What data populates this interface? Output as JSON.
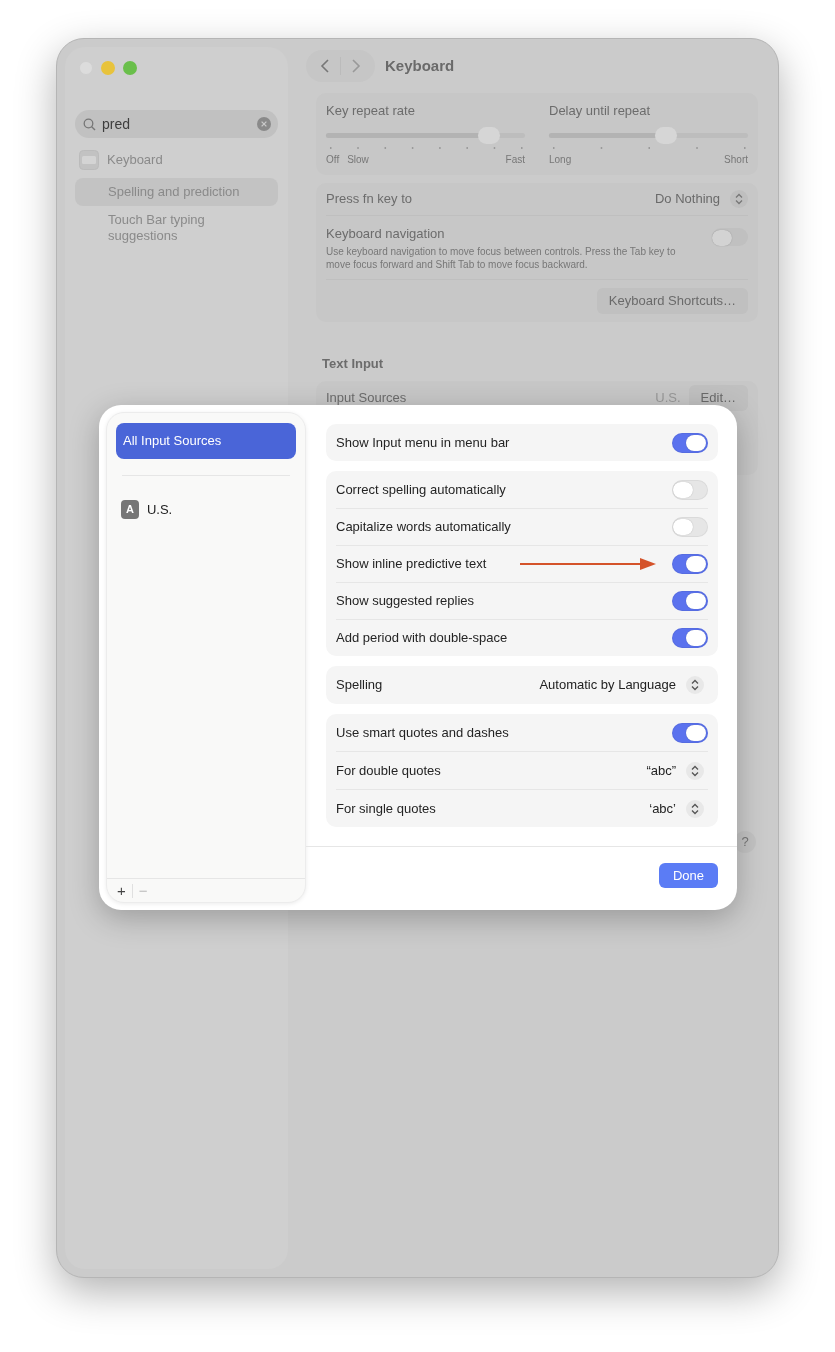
{
  "window": {
    "title": "Keyboard",
    "help": "?"
  },
  "sidebar": {
    "search": {
      "value": "pred"
    },
    "items": [
      {
        "label": "Keyboard",
        "kind": "category",
        "selected": false
      },
      {
        "label": "Spelling and prediction",
        "kind": "result",
        "selected": true
      },
      {
        "label": "Touch Bar typing suggestions",
        "kind": "result",
        "selected": false
      }
    ]
  },
  "sliders": [
    {
      "label": "Key repeat rate",
      "level": 0.82,
      "start_labels": [
        "Off",
        "Slow"
      ],
      "end_label": "Fast"
    },
    {
      "label": "Delay until repeat",
      "level": 0.59,
      "start_labels": [
        "Long"
      ],
      "end_label": "Short"
    }
  ],
  "fn_key": {
    "label": "Press fn key to",
    "value": "Do Nothing"
  },
  "keyboard_navigation": {
    "label": "Keyboard navigation",
    "description": "Use keyboard navigation to move focus between controls. Press the Tab key to move focus forward and Shift Tab to move focus backward.",
    "on": false
  },
  "shortcuts_button": "Keyboard Shortcuts…",
  "text_input": {
    "heading": "Text Input",
    "input_sources": {
      "label": "Input Sources",
      "value": "U.S.",
      "button": "Edit…"
    }
  },
  "sheet": {
    "sources": [
      {
        "label": "All Input Sources",
        "selected": true
      },
      {
        "label": "U.S.",
        "badge": "A",
        "selected": false
      }
    ],
    "list_buttons": [
      {
        "label": "+",
        "disabled": false
      },
      {
        "label": "−",
        "disabled": true
      }
    ],
    "groups": [
      [
        {
          "kind": "toggle",
          "label": "Show Input menu in menu bar",
          "on": true,
          "marked": false
        }
      ],
      [
        {
          "kind": "toggle",
          "label": "Correct spelling automatically",
          "on": false,
          "marked": false
        },
        {
          "kind": "toggle",
          "label": "Capitalize words automatically",
          "on": false,
          "marked": false
        },
        {
          "kind": "toggle",
          "label": "Show inline predictive text",
          "on": true,
          "marked": true
        },
        {
          "kind": "toggle",
          "label": "Show suggested replies",
          "on": true,
          "marked": false
        },
        {
          "kind": "toggle",
          "label": "Add period with double-space",
          "on": true,
          "marked": false
        }
      ],
      [
        {
          "kind": "popup",
          "label": "Spelling",
          "value": "Automatic by Language"
        }
      ],
      [
        {
          "kind": "toggle",
          "label": "Use smart quotes and dashes",
          "on": true,
          "marked": false
        },
        {
          "kind": "popup",
          "label": "For double quotes",
          "value": "“abc”"
        },
        {
          "kind": "popup",
          "label": "For single quotes",
          "value": "‘abc’"
        }
      ]
    ],
    "done": "Done"
  }
}
